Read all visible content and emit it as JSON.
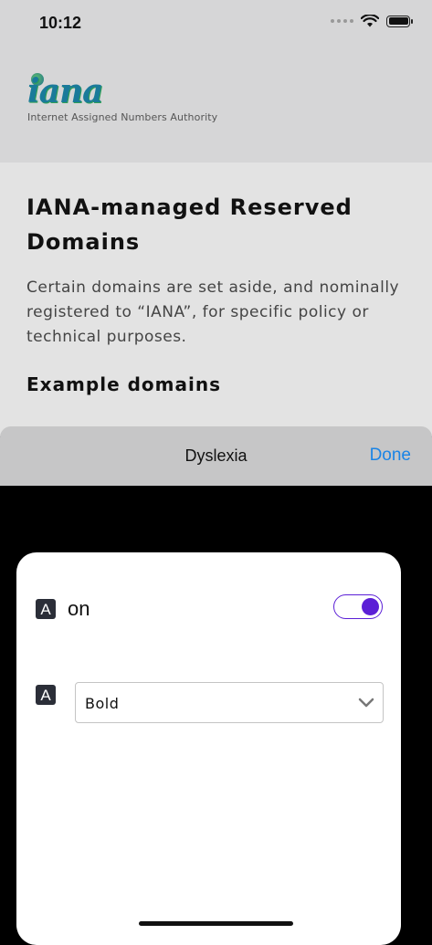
{
  "status_bar": {
    "time": "10:12"
  },
  "site": {
    "logo_word": "iana",
    "logo_subtitle": "Internet Assigned Numbers Authority"
  },
  "content": {
    "title": "IANA-managed Reserved Domains",
    "intro": "Certain domains are set aside, and nominally registered to “IANA”, for specific policy or technical purposes.",
    "section_title": "Example domains"
  },
  "sheet": {
    "title": "Dyslexia",
    "done_label": "Done"
  },
  "settings": {
    "icon_letter": "A",
    "toggle_label": "on",
    "toggle_on": true,
    "font_weight_selected": "Bold",
    "accent_color": "#5b1fd6"
  },
  "colors": {
    "done_blue": "#1a84e6",
    "header_bg": "#d6d6d7"
  },
  "icons": [
    "wifi-icon",
    "battery-icon",
    "signal-dots-icon",
    "text-a-icon",
    "chevron-down-icon",
    "iana-globe-icon"
  ]
}
